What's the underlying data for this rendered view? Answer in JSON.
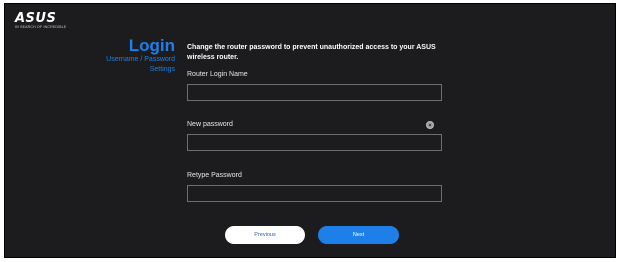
{
  "header": {
    "logo_text": "ASUS",
    "logo_tagline": "IN SEARCH OF INCREDIBLE"
  },
  "sidebar": {
    "title": "Login",
    "subtitle_line1": "Username / Password",
    "subtitle_line2": "Settings"
  },
  "main": {
    "instruction": "Change the router password to prevent unauthorized access to your ASUS wireless router.",
    "fields": [
      {
        "label": "Router Login Name",
        "value": "",
        "placeholder": ""
      },
      {
        "label": "New password",
        "value": "",
        "placeholder": ""
      },
      {
        "label": "Retype Password",
        "value": "",
        "placeholder": ""
      }
    ]
  },
  "buttons": {
    "previous_label": "Previous",
    "next_label": "Next"
  },
  "colors": {
    "background": "#1c1c1e",
    "accent": "#1f7fe8",
    "text": "#ffffff"
  },
  "icons": {
    "password_visibility": "eye-icon"
  }
}
